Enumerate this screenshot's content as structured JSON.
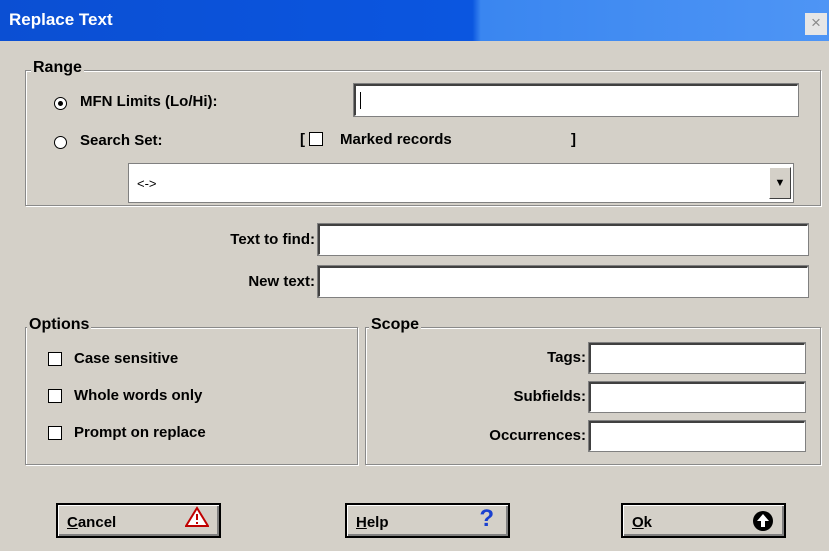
{
  "window": {
    "title": "Replace Text",
    "close_glyph": "×"
  },
  "range": {
    "legend": "Range",
    "mfn_label": "MFN Limits (Lo/Hi):",
    "mfn_value": "",
    "mfn_selected": true,
    "search_set_label": "Search Set:",
    "marked_open_bracket": "[",
    "marked_label": "Marked records",
    "marked_close_bracket": "]",
    "marked_checked": false,
    "dropdown_value": "<->"
  },
  "text_fields": {
    "find_label": "Text to find:",
    "find_value": "",
    "new_label": "New text:",
    "new_value": ""
  },
  "options": {
    "legend": "Options",
    "items": [
      {
        "label": "Case sensitive",
        "checked": false
      },
      {
        "label": "Whole words only",
        "checked": false
      },
      {
        "label": "Prompt on replace",
        "checked": false
      }
    ]
  },
  "scope": {
    "legend": "Scope",
    "tags_label": "Tags:",
    "subfields_label": "Subfields:",
    "occurrences_label": "Occurrences:"
  },
  "buttons": {
    "cancel_mnemonic": "C",
    "cancel_rest": "ancel",
    "cancel_icon": "warning-triangle-icon",
    "help_mnemonic": "H",
    "help_rest": "elp",
    "help_glyph": "?",
    "ok_mnemonic": "O",
    "ok_rest": "k",
    "ok_icon": "up-arrow-circle-icon"
  },
  "colors": {
    "titlebar": "#0b4fd3",
    "dialog_bg": "#d4d0c8",
    "help_icon": "#1a40d0",
    "cancel_icon": "#c00000"
  }
}
